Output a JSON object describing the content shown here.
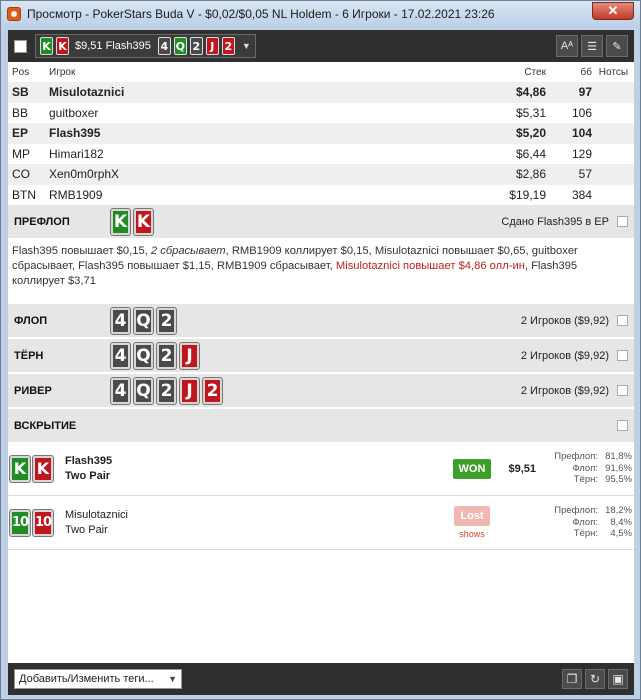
{
  "window": {
    "title": "Просмотр - PokerStars Buda V - $0,02/$0,05 NL Holdem - 6 Игроки - 17.02.2021 23:26",
    "close_glyph": "✕"
  },
  "header": {
    "hand_amount": "$9,51 Flash395",
    "hero_cards": [
      {
        "rank": "K",
        "suit": "c"
      },
      {
        "rank": "K",
        "suit": "h"
      }
    ],
    "board_cards": [
      {
        "rank": "4",
        "suit": "s"
      },
      {
        "rank": "Q",
        "suit": "c"
      },
      {
        "rank": "2",
        "suit": "s"
      },
      {
        "rank": "J",
        "suit": "h"
      },
      {
        "rank": "2",
        "suit": "h"
      }
    ],
    "icons": [
      "font-size-icon",
      "list-icon",
      "pencil-icon"
    ]
  },
  "players": {
    "columns": {
      "pos": "Pos",
      "name": "Игрок",
      "stack": "Стек",
      "bb": "бб",
      "notes": "Нотсы"
    },
    "rows": [
      {
        "pos": "SB",
        "name": "Misulotaznici",
        "stack": "$4,86",
        "bb": "97"
      },
      {
        "pos": "BB",
        "name": "guitboxer",
        "stack": "$5,31",
        "bb": "106"
      },
      {
        "pos": "EP",
        "name": "Flash395",
        "stack": "$5,20",
        "bb": "104"
      },
      {
        "pos": "MP",
        "name": "Himari182",
        "stack": "$6,44",
        "bb": "129"
      },
      {
        "pos": "CO",
        "name": "Xen0m0rphX",
        "stack": "$2,86",
        "bb": "57"
      },
      {
        "pos": "BTN",
        "name": "RMB1909",
        "stack": "$19,19",
        "bb": "384"
      }
    ]
  },
  "preflop": {
    "label": "ПРЕФЛОП",
    "info": "Сдано Flash395 в EP",
    "actions": {
      "p1": "Flash395 повышает $0,15, ",
      "p2": "2 сбрасывает",
      "p3": ", RMB1909 коллирует $0,15, Misulotaznici повышает $0,65, guitboxer сбрасывает, Flash395 повышает $1,15, RMB1909 сбрасывает, ",
      "p4": "Misulotaznici повышает $4,86 олл-ин",
      "p5": ", Flash395 коллирует $3,71"
    }
  },
  "flop": {
    "label": "ФЛОП",
    "info": "2 Игроков ($9,92)"
  },
  "turn": {
    "label": "ТЁРН",
    "info": "2 Игроков ($9,92)"
  },
  "river": {
    "label": "РИВЕР",
    "info": "2 Игроков ($9,92)"
  },
  "showdown": {
    "label": "ВСКРЫТИЕ"
  },
  "results": [
    {
      "name": "Flash395",
      "hand": "Two Pair",
      "badge": "WON",
      "amount": "$9,51",
      "cards": [
        {
          "rank": "K",
          "suit": "c"
        },
        {
          "rank": "K",
          "suit": "h"
        }
      ],
      "eq_labels": [
        "Префлоп:",
        "Флоп:",
        "Тёрн:"
      ],
      "eq_values": [
        "81,8%",
        "91,6%",
        "95,5%"
      ]
    },
    {
      "name": "Misulotaznici",
      "hand": "Two Pair",
      "badge": "Lost",
      "shows": "shows",
      "cards": [
        {
          "rank": "10",
          "suit": "c"
        },
        {
          "rank": "10",
          "suit": "h"
        }
      ],
      "eq_labels": [
        "Префлоп:",
        "Флоп:",
        "Тёрн:"
      ],
      "eq_values": [
        "18,2%",
        "8,4%",
        "4,5%"
      ]
    }
  ],
  "footer": {
    "tags_placeholder": "Добавить/Изменить теги...",
    "icons": [
      "copy-icon",
      "refresh-icon",
      "save-icon"
    ]
  },
  "colors": {
    "spade": "#4a4a4a",
    "heart": "#c0161d",
    "club": "#1f8d24",
    "won": "#3d9e2a",
    "lost": "#f0b8b1"
  }
}
